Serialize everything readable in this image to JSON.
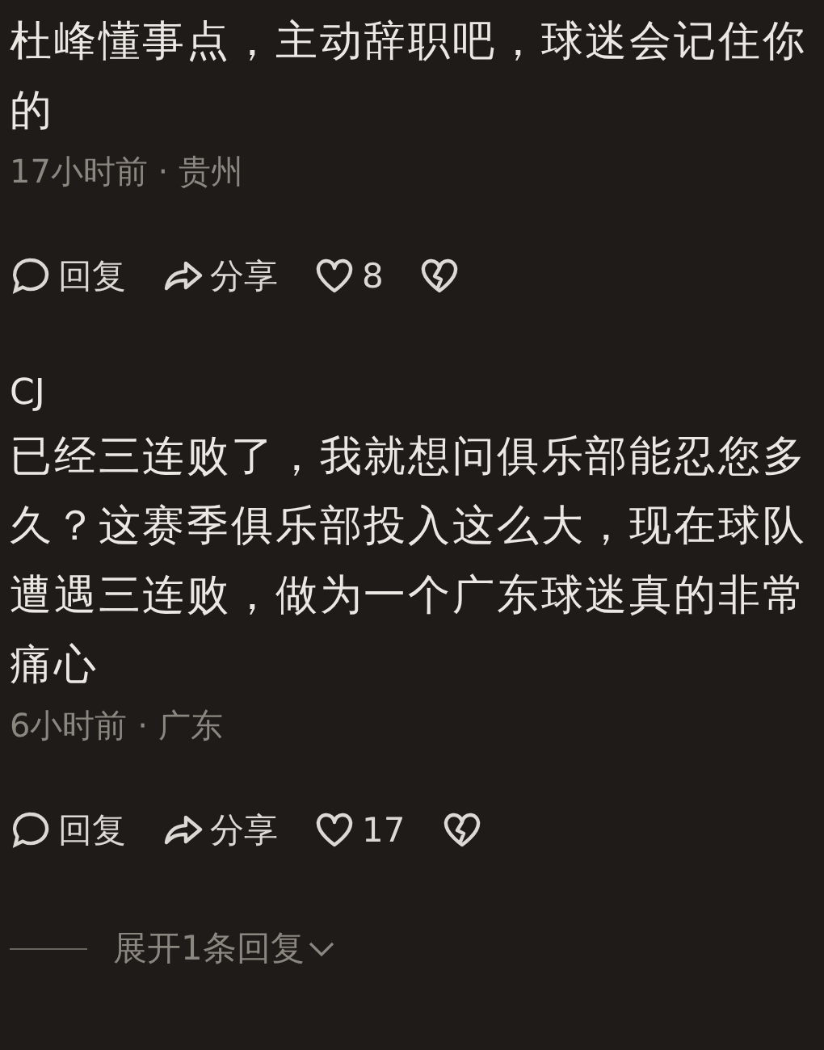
{
  "comments": [
    {
      "text": "杜峰懂事点，主动辞职吧，球迷会记住你的",
      "meta": "17小时前 · 贵州",
      "reply": "回复",
      "share": "分享",
      "likes": "8"
    },
    {
      "author": "CJ",
      "text": "已经三连败了，我就想问俱乐部能忍您多久？这赛季俱乐部投入这么大，现在球队遭遇三连败，做为一个广东球迷真的非常痛心",
      "meta": "6小时前 · 广东",
      "reply": "回复",
      "share": "分享",
      "likes": "17"
    }
  ],
  "expand": {
    "label": "展开1条回复"
  }
}
